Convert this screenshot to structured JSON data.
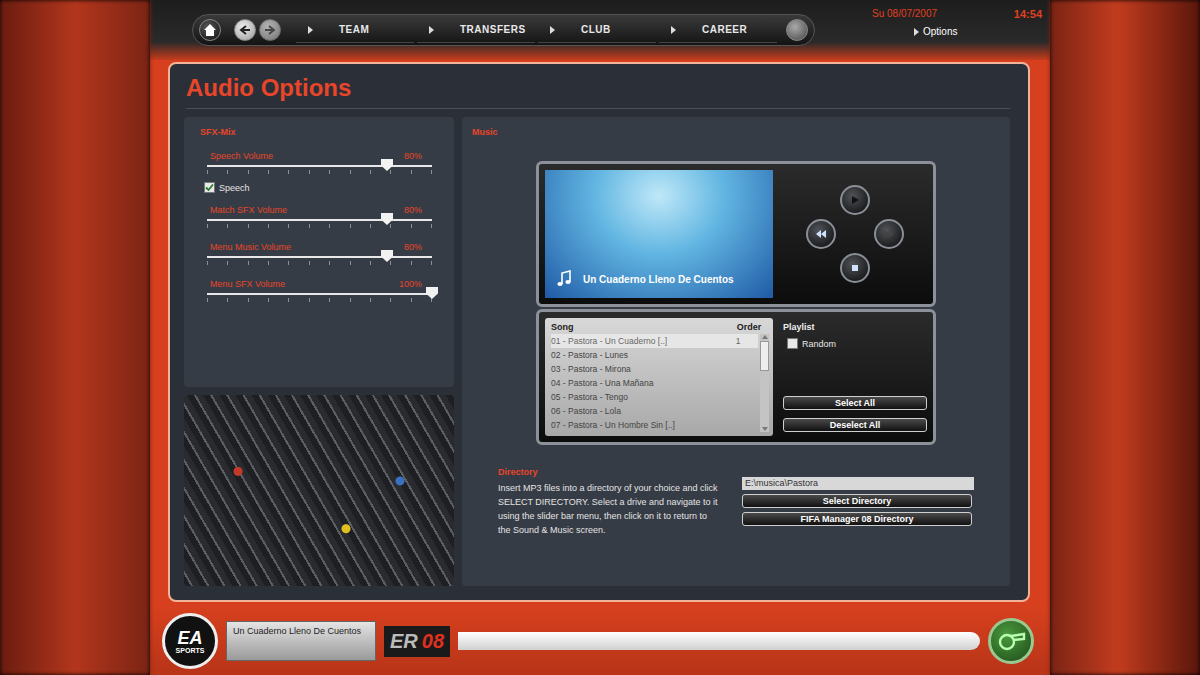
{
  "header": {
    "date": "Su 08/07/2007",
    "time": "14:54",
    "options": "Options"
  },
  "nav": {
    "tabs": [
      {
        "label": "TEAM",
        "selected": false
      },
      {
        "label": "TRANSFERS",
        "selected": false
      },
      {
        "label": "CLUB",
        "selected": false
      },
      {
        "label": "CAREER",
        "selected": false
      }
    ]
  },
  "page": {
    "title": "Audio Options"
  },
  "sfx_mix": {
    "title": "SFX-Mix",
    "rows": [
      {
        "kind": "slider",
        "label": "Speech Volume",
        "reading": "80%",
        "level": 0.8
      },
      {
        "kind": "checkbox",
        "label": "Speech",
        "checked": true
      },
      {
        "kind": "slider",
        "label": "Match SFX Volume",
        "reading": "80%",
        "level": 0.8
      },
      {
        "kind": "slider",
        "label": "Menu Music Volume",
        "reading": "80%",
        "level": 0.8
      },
      {
        "kind": "slider",
        "label": "Menu SFX Volume",
        "reading": "100%",
        "level": 1.0
      }
    ]
  },
  "music": {
    "title": "Music",
    "now_playing": "Un Cuaderno Lleno De Cuentos",
    "columns": [
      "Song",
      "Order"
    ],
    "rows": [
      {
        "song": "01 - Pastora - Un Cuaderno [..]",
        "order": "1",
        "selected": true
      },
      {
        "song": "02 - Pastora - Lunes",
        "order": "",
        "selected": false
      },
      {
        "song": "03 - Pastora - Mirona",
        "order": "",
        "selected": false
      },
      {
        "song": "04 - Pastora - Una Mañana",
        "order": "",
        "selected": false
      },
      {
        "song": "05 - Pastora - Tengo",
        "order": "",
        "selected": false
      },
      {
        "song": "06 - Pastora - Lola",
        "order": "",
        "selected": false
      },
      {
        "song": "07 - Pastora - Un Hombre Sin [..]",
        "order": "",
        "selected": false
      }
    ],
    "playlist_title": "Playlist",
    "random": {
      "label": "Random",
      "checked": false
    },
    "buttons": [
      "Select All",
      "Deselect All"
    ]
  },
  "directory": {
    "title": "Directory",
    "help": "Insert MP3 files into a directory of your choice and click SELECT DIRECTORY. Select a drive and navigate to it using the slider bar menu, then click on it to return to the Sound & Music screen.",
    "path": "E:\\musica\\Pastora",
    "buttons": [
      "Select Directory",
      "FIFA Manager 08 Directory"
    ]
  },
  "footer": {
    "now_playing": "Un Cuaderno Lleno De Cuentos",
    "logo": "EA",
    "logo_sub": "SPORTS",
    "brand": "ER",
    "brand_year": "08"
  }
}
